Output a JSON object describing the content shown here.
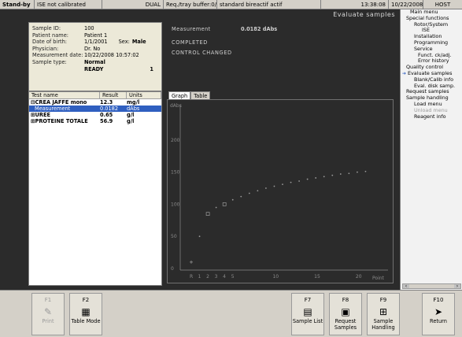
{
  "status": {
    "state": "Stand-by",
    "calibration": "ISE not calibrated",
    "mode": "DUAL",
    "tray": "Req./tray buffer:0/5",
    "buffer": "standard bireactif actif",
    "time": "13:38:08",
    "date": "10/22/2008",
    "host": "HOST"
  },
  "screen_title": "Evaluate samples",
  "patient": {
    "sample_id_label": "Sample ID:",
    "sample_id": "100",
    "name_label": "Patient name:",
    "name": "Patient 1",
    "dob_label": "Date of birth:",
    "dob": "1/1/2001",
    "sex_label": "Sex:",
    "sex": "Male",
    "physician_label": "Physician:",
    "physician": "Dr. No",
    "meas_date_label": "Measurement date:",
    "meas_date": "10/22/2008 10:57:02",
    "sample_type_label": "Sample type:",
    "sample_type": "Normal",
    "state": "READY",
    "count": "1"
  },
  "results": {
    "headers": [
      "Test name",
      "Result",
      "Units"
    ],
    "rows": [
      {
        "name": "⊟CREA JAFFE mono",
        "result": "12.3",
        "units": "mg/l"
      },
      {
        "name": "Measurement",
        "result": "0.0182",
        "units": "dAbs"
      },
      {
        "name": "⊞UREE",
        "result": "0.65",
        "units": "g/l"
      },
      {
        "name": "⊞PROTEINE TOTALE",
        "result": "56.9",
        "units": "g/l"
      }
    ]
  },
  "measurement": {
    "label": "Measurement",
    "value": "0.0182 dAbs",
    "completed": "COMPLETED",
    "control": "CONTROL CHANGED"
  },
  "tabs": [
    "Graph",
    "Table"
  ],
  "chart_data": {
    "type": "scatter",
    "ylabel": "dAbs",
    "xlabel": "Point",
    "x_ticks": [
      "R",
      "1",
      "2",
      "3",
      "4",
      "5",
      "10",
      "15",
      "20"
    ],
    "y_ticks": [
      "0",
      "50",
      "100",
      "150",
      "200"
    ],
    "ylim": [
      0,
      250
    ],
    "xlim": [
      0,
      22
    ],
    "points": [
      {
        "x": 0,
        "y": 10,
        "marker": "plus"
      },
      {
        "x": 1,
        "y": 50
      },
      {
        "x": 2,
        "y": 85,
        "marker": "square"
      },
      {
        "x": 3,
        "y": 95
      },
      {
        "x": 4,
        "y": 100,
        "marker": "square"
      },
      {
        "x": 5,
        "y": 107
      },
      {
        "x": 6,
        "y": 112
      },
      {
        "x": 7,
        "y": 117
      },
      {
        "x": 8,
        "y": 121
      },
      {
        "x": 9,
        "y": 125
      },
      {
        "x": 10,
        "y": 128
      },
      {
        "x": 11,
        "y": 131
      },
      {
        "x": 12,
        "y": 134
      },
      {
        "x": 13,
        "y": 136
      },
      {
        "x": 14,
        "y": 139
      },
      {
        "x": 15,
        "y": 141
      },
      {
        "x": 16,
        "y": 143
      },
      {
        "x": 17,
        "y": 145
      },
      {
        "x": 18,
        "y": 147
      },
      {
        "x": 19,
        "y": 148
      },
      {
        "x": 20,
        "y": 150
      },
      {
        "x": 21,
        "y": 151
      }
    ],
    "colors": {
      "point": "#9a9a9a",
      "axis": "#8a8a8a"
    }
  },
  "menu": [
    {
      "label": "Main menu",
      "indent": 2
    },
    {
      "label": "Special functions",
      "indent": 1
    },
    {
      "label": "Rotor/System",
      "indent": 3
    },
    {
      "label": "ISE",
      "indent": 5
    },
    {
      "label": "Installation",
      "indent": 3
    },
    {
      "label": "Programming",
      "indent": 3
    },
    {
      "label": "Service",
      "indent": 3
    },
    {
      "label": "Funct. ck/adj.",
      "indent": 4
    },
    {
      "label": "Error history",
      "indent": 4
    },
    {
      "label": "Quality control",
      "indent": 1
    },
    {
      "label": "Evaluate samples",
      "indent": 0,
      "selected": true
    },
    {
      "label": "Blank/Calib info",
      "indent": 3
    },
    {
      "label": "Eval. disk samp.",
      "indent": 3
    },
    {
      "label": "Request samples",
      "indent": 1
    },
    {
      "label": "Sample handling",
      "indent": 1
    },
    {
      "label": "Load menu",
      "indent": 3
    },
    {
      "label": "Unload menu",
      "indent": 3,
      "disabled": true
    },
    {
      "label": "Reagent info",
      "indent": 3
    }
  ],
  "fkeys": [
    {
      "id": "F1",
      "label": "Print",
      "icon": "printer-icon",
      "glyph": "✎",
      "disabled": true
    },
    {
      "id": "F2",
      "label": "Table Mode",
      "icon": "table-icon",
      "glyph": "▦",
      "disabled": false
    },
    {
      "id": "F7",
      "label": "Sample List",
      "icon": "list-icon",
      "glyph": "▤",
      "disabled": false
    },
    {
      "id": "F8",
      "label": "Request Samples",
      "icon": "request-icon",
      "glyph": "▣",
      "disabled": false
    },
    {
      "id": "F9",
      "label": "Sample Handling",
      "icon": "rack-icon",
      "glyph": "⊞",
      "disabled": false
    },
    {
      "id": "F10",
      "label": "Return",
      "icon": "return-arrow-icon",
      "glyph": "➤",
      "disabled": false
    }
  ]
}
